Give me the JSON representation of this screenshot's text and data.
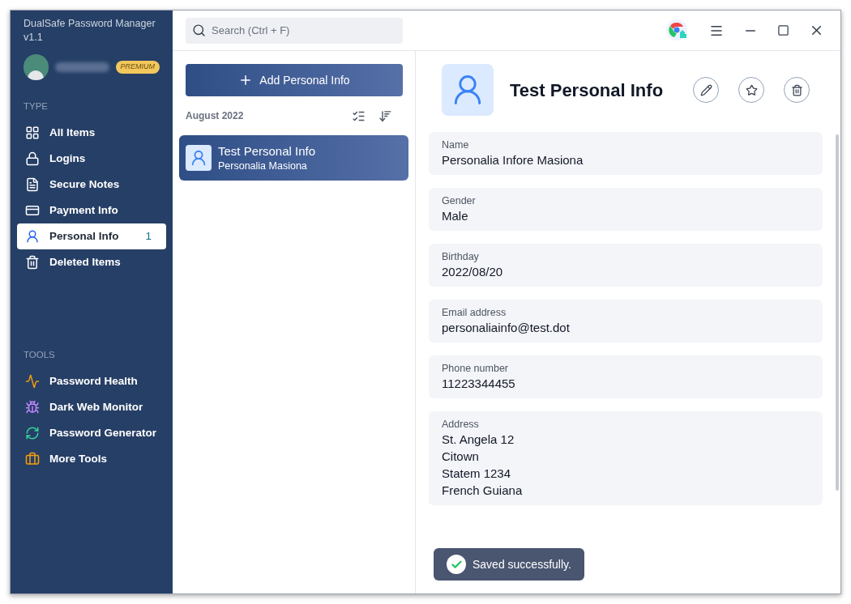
{
  "app": {
    "title": "DualSafe Password Manager",
    "version": "v1.1",
    "badge": "PREMIUM"
  },
  "sidebar": {
    "sections": [
      {
        "heading": "TYPE",
        "items": [
          {
            "label": "All Items",
            "selected": false
          },
          {
            "label": "Logins",
            "selected": false
          },
          {
            "label": "Secure Notes",
            "selected": false
          },
          {
            "label": "Payment Info",
            "selected": false
          },
          {
            "label": "Personal Info",
            "selected": true,
            "count": "1"
          },
          {
            "label": "Deleted Items",
            "selected": false
          }
        ]
      },
      {
        "heading": "TOOLS",
        "items": [
          {
            "label": "Password Health",
            "selected": false
          },
          {
            "label": "Dark Web Monitor",
            "selected": false
          },
          {
            "label": "Password Generator",
            "selected": false
          },
          {
            "label": "More Tools",
            "selected": false
          }
        ]
      }
    ]
  },
  "search": {
    "placeholder": "Search (Ctrl + F)"
  },
  "list": {
    "add_button": "Add Personal Info",
    "group": "August 2022",
    "items": [
      {
        "title": "Test Personal Info",
        "subtitle": "Personalia Masiona",
        "selected": true
      }
    ]
  },
  "detail": {
    "title": "Test Personal Info",
    "fields": [
      {
        "label": "Name",
        "lines": [
          "Personalia Infore Masiona"
        ]
      },
      {
        "label": "Gender",
        "lines": [
          "Male"
        ]
      },
      {
        "label": "Birthday",
        "lines": [
          "2022/08/20"
        ]
      },
      {
        "label": "Email address",
        "lines": [
          "personaliainfo@test.dot"
        ]
      },
      {
        "label": "Phone number",
        "lines": [
          "11223344455"
        ]
      },
      {
        "label": "Address",
        "lines": [
          "St. Angela 12",
          "Citown",
          "Statem 1234",
          "French Guiana"
        ]
      }
    ]
  },
  "toast": {
    "message": "Saved successfully."
  }
}
